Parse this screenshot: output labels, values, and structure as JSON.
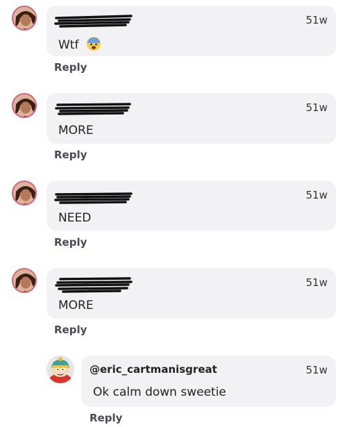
{
  "comments": [
    {
      "username": "",
      "time": "51w",
      "text": "Wtf",
      "emoji": "fearful-face-icon",
      "reply_label": "Reply"
    },
    {
      "username": "",
      "time": "51w",
      "text": "MORE",
      "reply_label": "Reply"
    },
    {
      "username": "",
      "time": "51w",
      "text": "NEED",
      "reply_label": "Reply"
    },
    {
      "username": "",
      "time": "51w",
      "text": "MORE",
      "reply_label": "Reply"
    }
  ],
  "reply_comment": {
    "username": "@eric_cartmanisgreat",
    "time": "51w",
    "text": "Ok calm down sweetie",
    "reply_label": "Reply"
  },
  "colors": {
    "bubble": "#f2f2f4",
    "avatar_ring": "#e0607a",
    "reply_text": "#4a4a55"
  }
}
